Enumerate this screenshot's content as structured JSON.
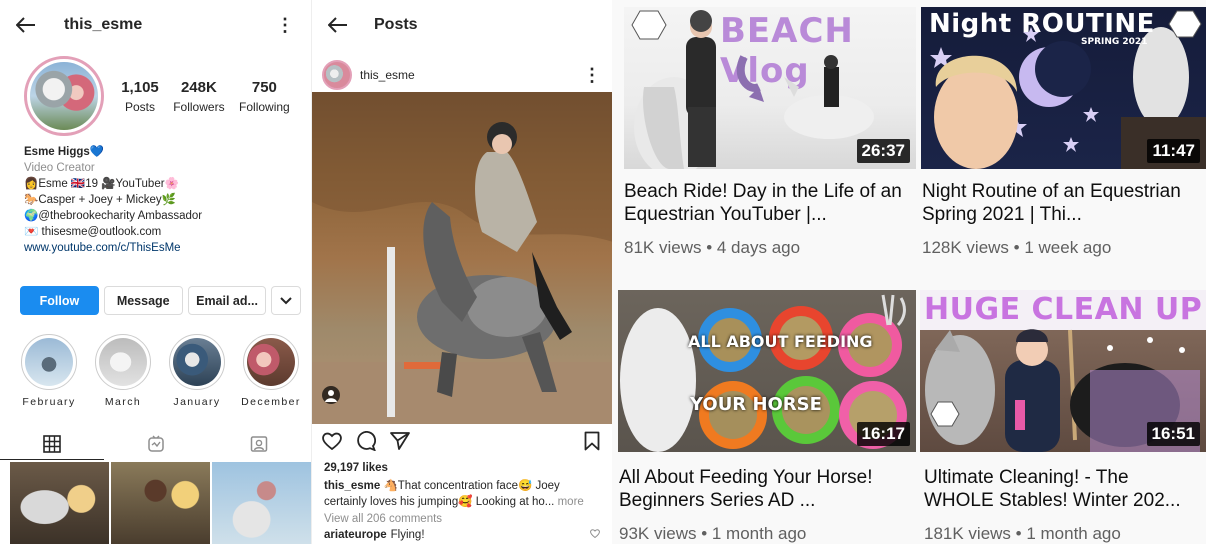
{
  "profile": {
    "username": "this_esme",
    "stats": [
      {
        "num": "1,105",
        "label": "Posts"
      },
      {
        "num": "248K",
        "label": "Followers"
      },
      {
        "num": "750",
        "label": "Following"
      }
    ],
    "bio": {
      "name": "Esme Higgs",
      "heart": "💙",
      "category": "Video Creator",
      "lines": [
        "👩Esme 🇬🇧19 🎥YouTuber🌸",
        "🐎Casper + Joey + Mickey🌿",
        "🌍@thebrookecharity Ambassador",
        "💌 thisesme@outlook.com"
      ],
      "link": "www.youtube.com/c/ThisEsMe"
    },
    "buttons": {
      "follow": "Follow",
      "message": "Message",
      "email": "Email ad...",
      "more": "⌄"
    },
    "highlights": [
      {
        "label": "February",
        "color": "#9bbad6"
      },
      {
        "label": "March",
        "color": "#d9d9d9"
      },
      {
        "label": "January",
        "color": "#3a5a7a"
      },
      {
        "label": "December",
        "color": "#c05a6a"
      }
    ]
  },
  "post": {
    "header_title": "Posts",
    "username": "this_esme",
    "likes": "29,197 likes",
    "caption_user": "this_esme",
    "caption_text": "🐴That concentration face😅 Joey certainly loves his jumping🥰 Looking at ho...",
    "caption_more": "more",
    "view_comments": "View all 206 comments",
    "comment_user": "ariateurope",
    "comment_text": "Flying!"
  },
  "videos": [
    {
      "title": "Beach Ride! Day in the Life of an Equestrian YouTuber |...",
      "meta": "81K views • 4 days ago",
      "duration": "26:37",
      "thumb_text": "BEACH Vlog"
    },
    {
      "title": "Night Routine of an Equestrian Spring 2021 | Thi...",
      "meta": "128K views • 1 week ago",
      "duration": "11:47",
      "thumb_text": "Night ROUTINE",
      "thumb_sub": "SPRING 2021"
    },
    {
      "title": "All About Feeding Your Horse! Beginners Series AD ...",
      "meta": "93K views • 1 month ago",
      "duration": "16:17",
      "thumb_text": "ALL ABOUT FEEDING",
      "thumb_text2": "YOUR HORSE"
    },
    {
      "title": "Ultimate Cleaning! - The WHOLE Stables! Winter 202...",
      "meta": "181K views • 1 month ago",
      "duration": "16:51",
      "thumb_text": "HUGE CLEAN UP"
    }
  ],
  "colors": {
    "follow_blue": "#1a8cf0",
    "link_blue": "#00376b",
    "story_ring": "#e3a0b8"
  }
}
